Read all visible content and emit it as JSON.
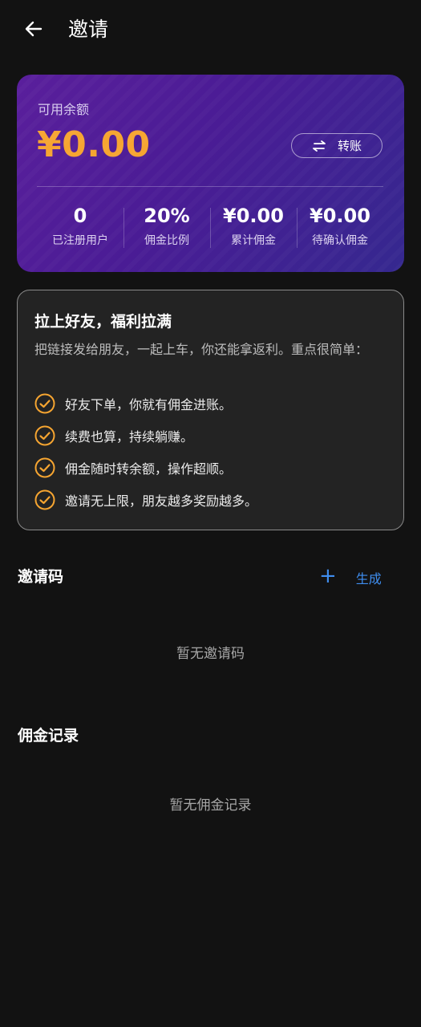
{
  "header": {
    "title": "邀请"
  },
  "balance_card": {
    "label": "可用余额",
    "amount": "¥0.00",
    "transfer_label": "转账",
    "stats": [
      {
        "value": "0",
        "label": "已注册用户"
      },
      {
        "value": "20%",
        "label": "佣金比例"
      },
      {
        "value": "¥0.00",
        "label": "累计佣金"
      },
      {
        "value": "¥0.00",
        "label": "待确认佣金"
      }
    ]
  },
  "promo": {
    "title": "拉上好友，福利拉满",
    "description": "把链接发给朋友，一起上车，你还能拿返利。重点很简单：",
    "benefits": [
      "好友下单，你就有佣金进账。",
      "续费也算，持续躺赚。",
      "佣金随时转余额，操作超顺。",
      "邀请无上限，朋友越多奖励越多。"
    ]
  },
  "invite_codes": {
    "title": "邀请码",
    "generate_label": "生成",
    "empty_text": "暂无邀请码"
  },
  "commission_records": {
    "title": "佣金记录",
    "empty_text": "暂无佣金记录"
  },
  "colors": {
    "accent_orange": "#f6a531",
    "accent_blue": "#3f8ef0",
    "background": "#121212"
  }
}
